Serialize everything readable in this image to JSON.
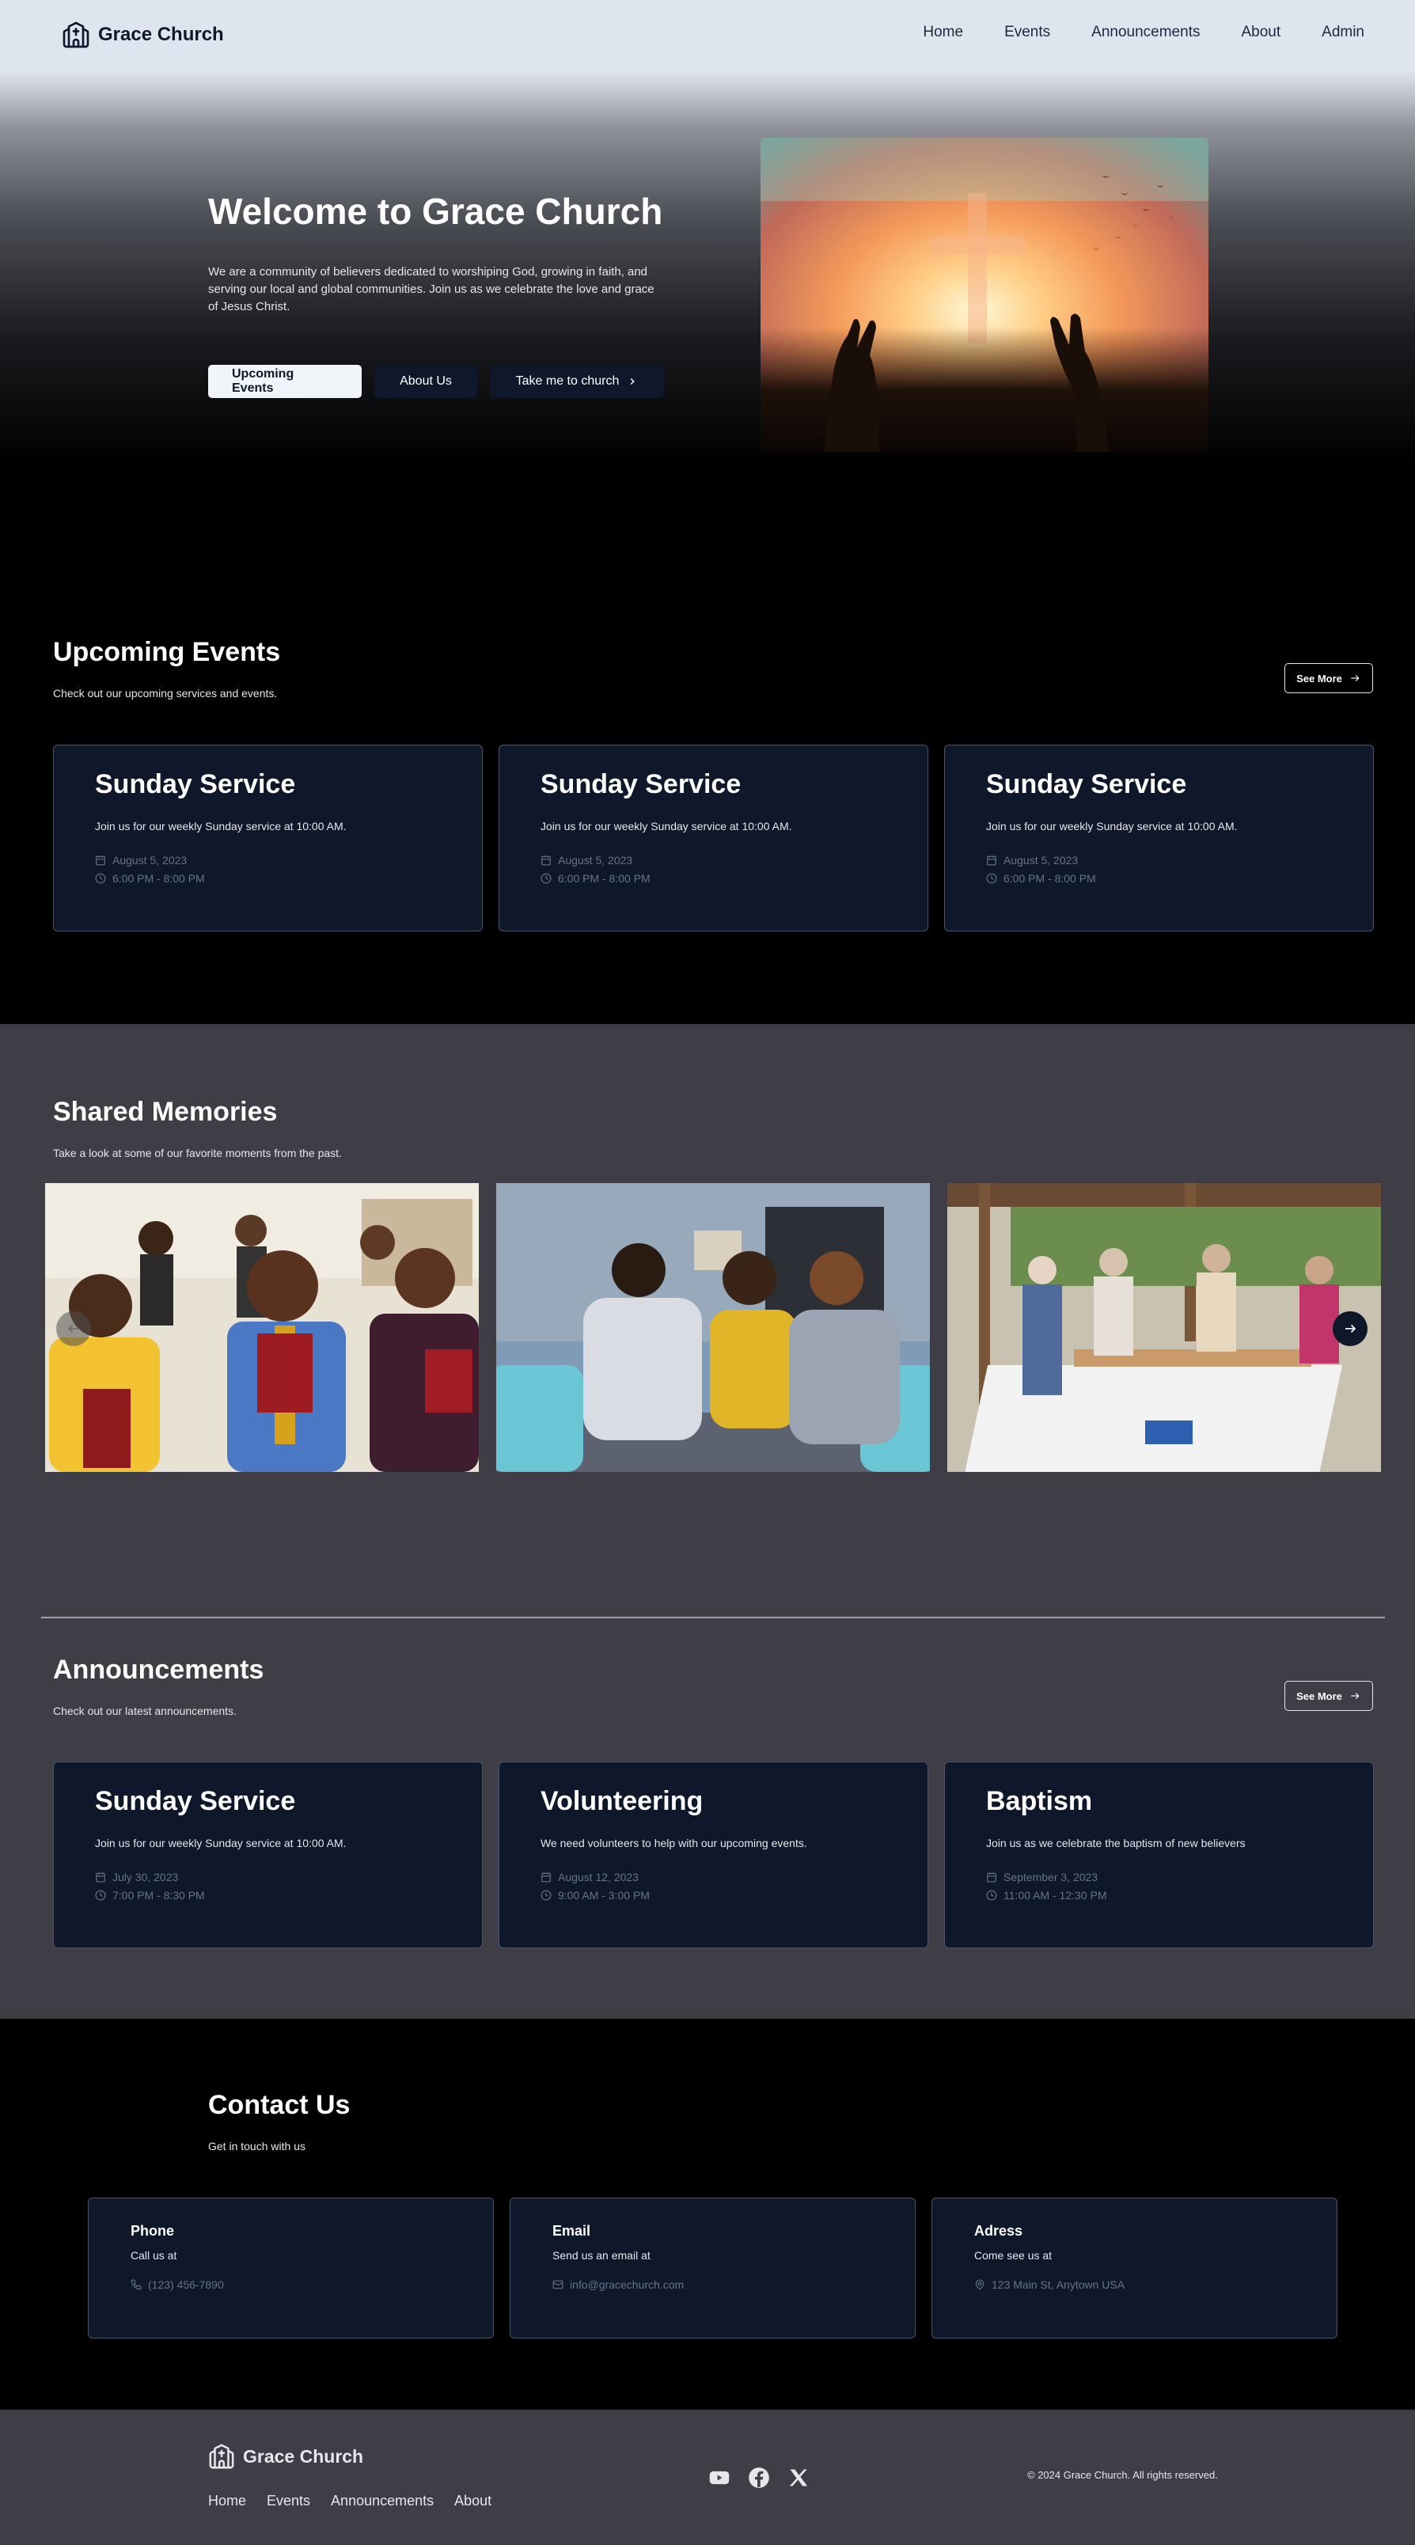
{
  "nav": {
    "brand": "Grace Church",
    "links": [
      "Home",
      "Events",
      "Announcements",
      "About",
      "Admin"
    ]
  },
  "hero": {
    "title": "Welcome to Grace Church",
    "text": "We are a community of believers dedicated to worshiping God, growing in faith, and serving our local and global communities. Join us as we celebrate the love and grace of Jesus Christ.",
    "buttons": [
      "Upcoming Events",
      "About Us",
      "Take me to church"
    ],
    "image_icon": "worship-hands-sunset-image"
  },
  "events": {
    "title": "Upcoming Events",
    "subtitle": "Check out our upcoming services and events.",
    "see_more": "See More",
    "cards": [
      {
        "title": "Sunday Service",
        "desc": "Join us for our weekly Sunday service at 10:00 AM.",
        "date": "August 5, 2023",
        "time": "6:00 PM - 8:00 PM"
      },
      {
        "title": "Sunday Service",
        "desc": "Join us for our weekly Sunday service at 10:00 AM.",
        "date": "August 5, 2023",
        "time": "6:00 PM - 8:00 PM"
      },
      {
        "title": "Sunday Service",
        "desc": "Join us for our weekly Sunday service at 10:00 AM.",
        "date": "August 5, 2023",
        "time": "6:00 PM - 8:00 PM"
      }
    ]
  },
  "memories": {
    "title": "Shared Memories",
    "subtitle": "Take a look at some of our favorite moments from the past.",
    "images": [
      "congregation-with-bibles-photo",
      "small-group-discussion-photo",
      "community-picnic-photo"
    ]
  },
  "announcements": {
    "title": "Announcements",
    "subtitle": "Check out our latest announcements.",
    "see_more": "See More",
    "cards": [
      {
        "title": "Sunday Service",
        "desc": "Join us for our weekly Sunday service at 10:00 AM.",
        "date": "July 30, 2023",
        "time": "7:00 PM - 8:30 PM"
      },
      {
        "title": "Volunteering",
        "desc": "We need volunteers to help with our upcoming events.",
        "date": "August 12, 2023",
        "time": "9:00 AM - 3:00 PM"
      },
      {
        "title": "Baptism",
        "desc": "Join us as we celebrate the baptism of new believers",
        "date": "September 3, 2023",
        "time": "11:00 AM - 12:30 PM"
      }
    ]
  },
  "contact": {
    "title": "Contact Us",
    "subtitle": "Get in touch with us",
    "cards": [
      {
        "title": "Phone",
        "sub": "Call us at",
        "value": "(123) 456-7890",
        "icon": "phone-icon"
      },
      {
        "title": "Email",
        "sub": "Send us an email at",
        "value": "info@gracechurch.com",
        "icon": "mail-icon"
      },
      {
        "title": "Adress",
        "sub": "Come see us at",
        "value": "123 Main St, Anytown USA",
        "icon": "map-pin-icon"
      }
    ]
  },
  "footer": {
    "brand": "Grace Church",
    "links": [
      "Home",
      "Events",
      "Announcements",
      "About"
    ],
    "social": [
      "youtube-icon",
      "facebook-icon",
      "x-icon"
    ],
    "copyright": "© 2024 Grace Church. All rights reserved."
  },
  "colors": {
    "nav_bg": "#dfe5ee",
    "card_bg": "#0f172a",
    "section_gray": "#3f3e46",
    "muted_text": "#64748b"
  }
}
